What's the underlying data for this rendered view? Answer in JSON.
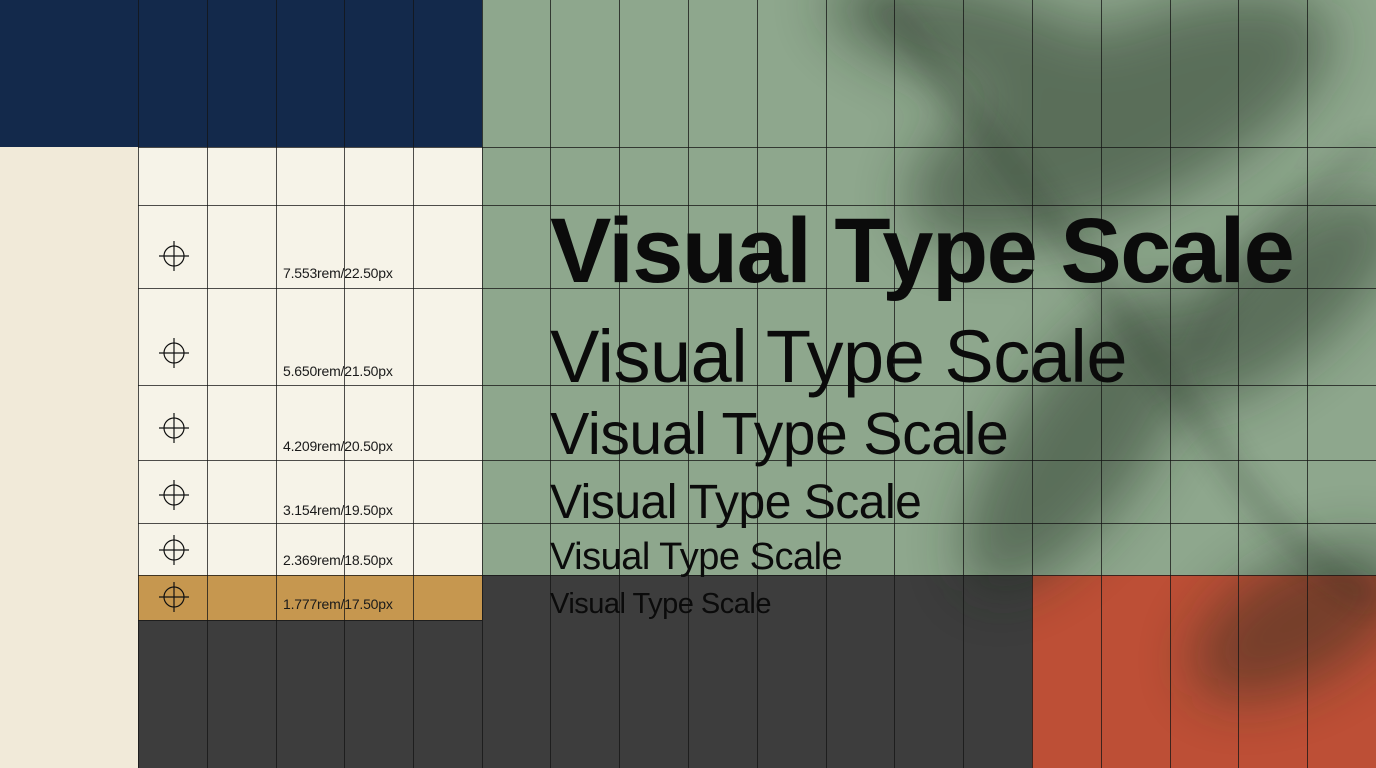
{
  "palette": {
    "navy": "#13294b",
    "beige": "#f1ead9",
    "cream": "#f6f3e8",
    "gold": "#c6974f",
    "sage_green": "#8ea78d",
    "charcoal": "#3d3d3d",
    "terracotta": "#bd4f36"
  },
  "scale": [
    {
      "label": "7.553rem/22.50px",
      "sample": "Visual Type Scale",
      "weight": "bold"
    },
    {
      "label": "5.650rem/21.50px",
      "sample": "Visual Type Scale",
      "weight": "regular"
    },
    {
      "label": "4.209rem/20.50px",
      "sample": "Visual Type Scale",
      "weight": "regular"
    },
    {
      "label": "3.154rem/19.50px",
      "sample": "Visual Type Scale",
      "weight": "regular"
    },
    {
      "label": "2.369rem/18.50px",
      "sample": "Visual Type Scale",
      "weight": "regular"
    },
    {
      "label": "1.777rem/17.50px",
      "sample": "Visual Type Scale",
      "weight": "regular"
    }
  ],
  "icons": {
    "marker": "crosshair-icon"
  }
}
